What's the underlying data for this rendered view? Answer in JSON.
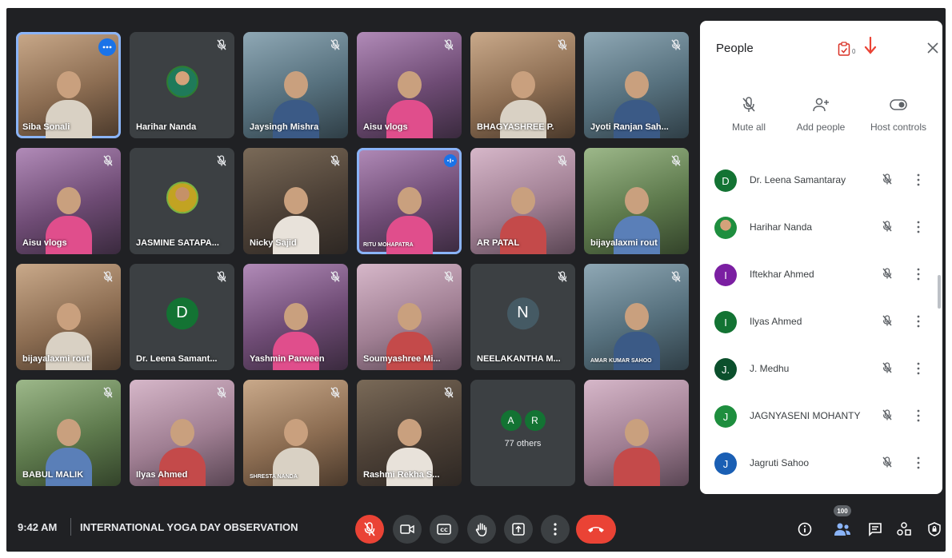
{
  "tiles": [
    {
      "name": "Siba Sonali",
      "type": "video",
      "variant": "v4",
      "active": true,
      "menu": true
    },
    {
      "name": "Harihar Nanda",
      "type": "avatar-photo"
    },
    {
      "name": "Jaysingh Mishra",
      "type": "video",
      "variant": "v3"
    },
    {
      "name": "Aisu vlogs",
      "type": "video",
      "variant": "v2"
    },
    {
      "name": "BHAGYASHREE P.",
      "type": "video",
      "variant": "v4"
    },
    {
      "name": "Jyoti Ranjan Sah...",
      "type": "video",
      "variant": "v3"
    },
    {
      "name": "Aisu vlogs",
      "type": "video",
      "variant": "v2"
    },
    {
      "name": "JASMINE SATAPA...",
      "type": "avatar-photo2"
    },
    {
      "name": "Nicky Sajid",
      "type": "video",
      "variant": "v1"
    },
    {
      "name": "RITU MOHAPATRA",
      "type": "video",
      "variant": "v2",
      "active": true,
      "speaking": true,
      "small": true
    },
    {
      "name": "AR PATAL",
      "type": "video",
      "variant": "v6"
    },
    {
      "name": "bijayalaxmi rout",
      "type": "video",
      "variant": "v5"
    },
    {
      "name": "bijayalaxmi rout",
      "type": "video",
      "variant": "v4"
    },
    {
      "name": "Dr. Leena Samant...",
      "type": "letter",
      "letter": "D",
      "color": "#137333"
    },
    {
      "name": "Yashmin Parween",
      "type": "video",
      "variant": "v2"
    },
    {
      "name": "Soumyashree Mi...",
      "type": "video",
      "variant": "v6"
    },
    {
      "name": "NEELAKANTHA M...",
      "type": "letter",
      "letter": "N",
      "color": "#455a64"
    },
    {
      "name": "AMAR KUMAR SAHOO",
      "type": "video",
      "variant": "v3",
      "small": true
    },
    {
      "name": "BABUL MALIK",
      "type": "video",
      "variant": "v5"
    },
    {
      "name": "Ilyas Ahmed",
      "type": "video",
      "variant": "v6"
    },
    {
      "name": "SHRESTA NANDA",
      "type": "video",
      "variant": "v4",
      "small": true
    },
    {
      "name": "Rashmi Rekha S...",
      "type": "video",
      "variant": "v1"
    },
    {
      "name": "77 others",
      "type": "others",
      "letters": [
        "A",
        "R"
      ]
    },
    {
      "name": "",
      "type": "video",
      "variant": "v6",
      "nomic": true
    }
  ],
  "panel": {
    "title": "People",
    "count": "0",
    "actions": [
      {
        "label": "Mute all",
        "icon": "mute-all-icon"
      },
      {
        "label": "Add people",
        "icon": "add-people-icon"
      },
      {
        "label": "Host controls",
        "icon": "host-controls-icon"
      }
    ],
    "participants": [
      {
        "name": "Dr. Leena Samantaray",
        "initial": "D",
        "color": "#137333"
      },
      {
        "name": "Harihar Nanda",
        "initial": "",
        "color": "#1e8e3e",
        "photo": true
      },
      {
        "name": "Iftekhar Ahmed",
        "initial": "I",
        "color": "#7b1fa2"
      },
      {
        "name": "Ilyas Ahmed",
        "initial": "I",
        "color": "#137333"
      },
      {
        "name": "J. Medhu",
        "initial": "J.",
        "color": "#0b4f2c"
      },
      {
        "name": "JAGNYASENI MOHANTY",
        "initial": "J",
        "color": "#1e8e3e"
      },
      {
        "name": "Jagruti Sahoo",
        "initial": "J",
        "color": "#1a5fb4"
      }
    ]
  },
  "bottom": {
    "time": "9:42 AM",
    "meeting_title": "INTERNATIONAL YOGA DAY OBSERVATION",
    "participants_count": "100"
  },
  "icons": {
    "mic_off": "mic-off-icon",
    "camera": "camera-icon",
    "captions": "captions-icon",
    "hand": "raise-hand-icon",
    "present": "present-icon",
    "more": "more-options-icon",
    "end": "end-call-icon",
    "info": "info-icon",
    "people": "people-icon",
    "chat": "chat-icon",
    "activities": "activities-icon",
    "lock": "host-lock-icon"
  }
}
